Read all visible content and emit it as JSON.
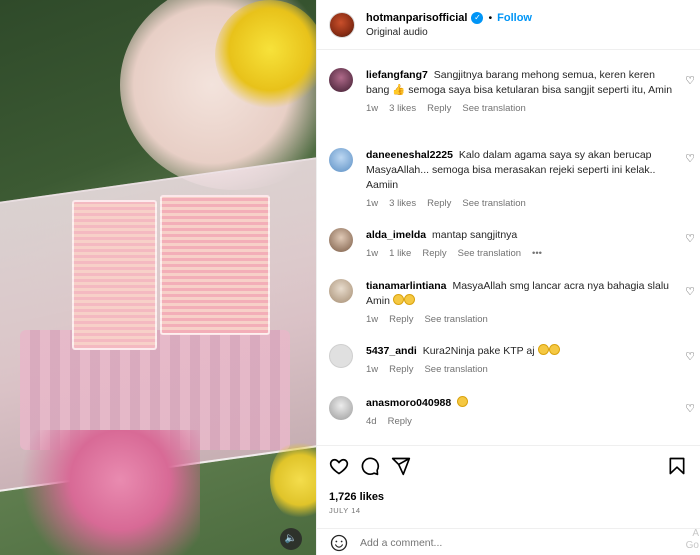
{
  "post": {
    "username": "hotmanparisofficial",
    "dot": "•",
    "follow_label": "Follow",
    "audio": "Original audio"
  },
  "comments": [
    {
      "username": "liefangfang7",
      "text_before": "Sangjitnya barang mehong semua, keren keren bang",
      "emoji_1": "thumbs-up",
      "text_after": "semoga saya bisa ketularan bisa sangjit seperti itu, Amin",
      "time": "1w",
      "likes": "3 likes",
      "reply": "Reply",
      "translation": "See translation"
    },
    {
      "username": "daneeneshal2225",
      "text": "Kalo dalam agama saya sy akan berucap MasyaAllah... semoga bisa merasakan rejeki seperti ini kelak.. Aamiin",
      "time": "1w",
      "likes": "3 likes",
      "reply": "Reply",
      "translation": "See translation"
    },
    {
      "username": "alda_imelda",
      "text": "mantap sangjitnya",
      "time": "1w",
      "likes": "1 like",
      "reply": "Reply",
      "translation": "See translation",
      "more": "•••"
    },
    {
      "username": "tianamarlintiana",
      "text": "MasyaAllah smg lancar acra nya bahagia slalu Amin",
      "emoji": "hands",
      "time": "1w",
      "reply": "Reply",
      "translation": "See translation"
    },
    {
      "username": "5437_andi",
      "text": "Kura2Ninja pake KTP aj",
      "emoji": "rofl",
      "time": "1w",
      "reply": "Reply",
      "translation": "See translation"
    },
    {
      "username": "anasmoro040988",
      "emoji": "smiling-face",
      "time": "4d",
      "reply": "Reply"
    }
  ],
  "actions": {
    "likes": "1,726 likes",
    "date": "JULY 14",
    "comment_placeholder": "Add a comment..."
  },
  "watermark": {
    "line1": "A",
    "line2": "Go"
  },
  "icons": {
    "verified": "verified-badge-icon",
    "heart": "heart-icon",
    "comment": "comment-icon",
    "share": "share-icon",
    "bookmark": "bookmark-icon",
    "emoji": "emoji-icon",
    "sound": "speaker-icon"
  },
  "colors": {
    "accent": "#0095f6",
    "muted": "#737373"
  }
}
